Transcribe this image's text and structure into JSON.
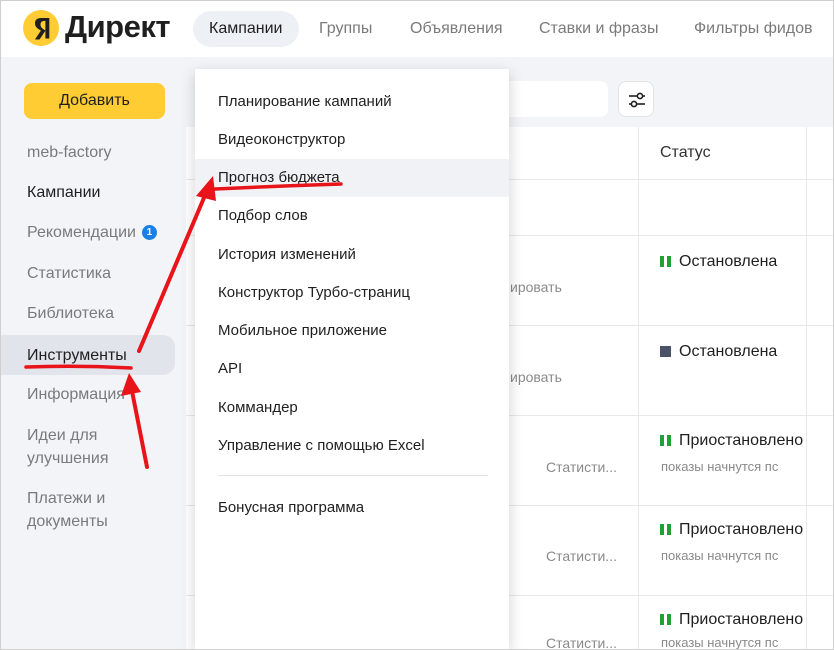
{
  "header": {
    "brand": "Директ",
    "tabs": [
      {
        "label": "Кампании",
        "active": true
      },
      {
        "label": "Группы"
      },
      {
        "label": "Объявления"
      },
      {
        "label": "Ставки и фразы"
      },
      {
        "label": "Фильтры фидов"
      }
    ]
  },
  "sidebar": {
    "add_label": "Добавить",
    "items": [
      {
        "label": "meb-factory"
      },
      {
        "label": "Кампании"
      },
      {
        "label": "Рекомендации",
        "badge": "1"
      },
      {
        "label": "Статистика"
      },
      {
        "label": "Библиотека"
      },
      {
        "label": "Инструменты"
      },
      {
        "label": "Информация"
      },
      {
        "label": "Идеи для улучшения"
      },
      {
        "label": "Платежи и документы"
      }
    ]
  },
  "table": {
    "status_header": "Статус",
    "rows": [
      {
        "status": "Остановлена",
        "icon": "pause-icon",
        "partial": "ировать"
      },
      {
        "status": "Остановлена",
        "icon": "stop-icon",
        "partial": "ировать"
      },
      {
        "status": "Приостановлено",
        "icon": "pause-icon",
        "note": "показы начнутся пс",
        "stat": "Статисти..."
      },
      {
        "status": "Приостановлено",
        "icon": "pause-icon",
        "note": "показы начнутся пс",
        "stat": "Статисти..."
      },
      {
        "status": "Приостановлено",
        "icon": "pause-icon",
        "note": "показы начнутся пс",
        "stat": "Статисти..."
      }
    ]
  },
  "tools_menu": {
    "items": [
      "Планирование кампаний",
      "Видеоконструктор",
      "Прогноз бюджета",
      "Подбор слов",
      "История изменений",
      "Конструктор Турбо-страниц",
      "Мобильное приложение",
      "API",
      "Коммандер",
      "Управление с помощью Excel"
    ],
    "extra_item": "Бонусная программа",
    "highlighted": "Прогноз бюджета"
  },
  "colors": {
    "brand_yellow": "#ffcc33",
    "annotation_red": "#e8141a",
    "status_green": "#21a038",
    "badge_blue": "#1b7fe8"
  }
}
